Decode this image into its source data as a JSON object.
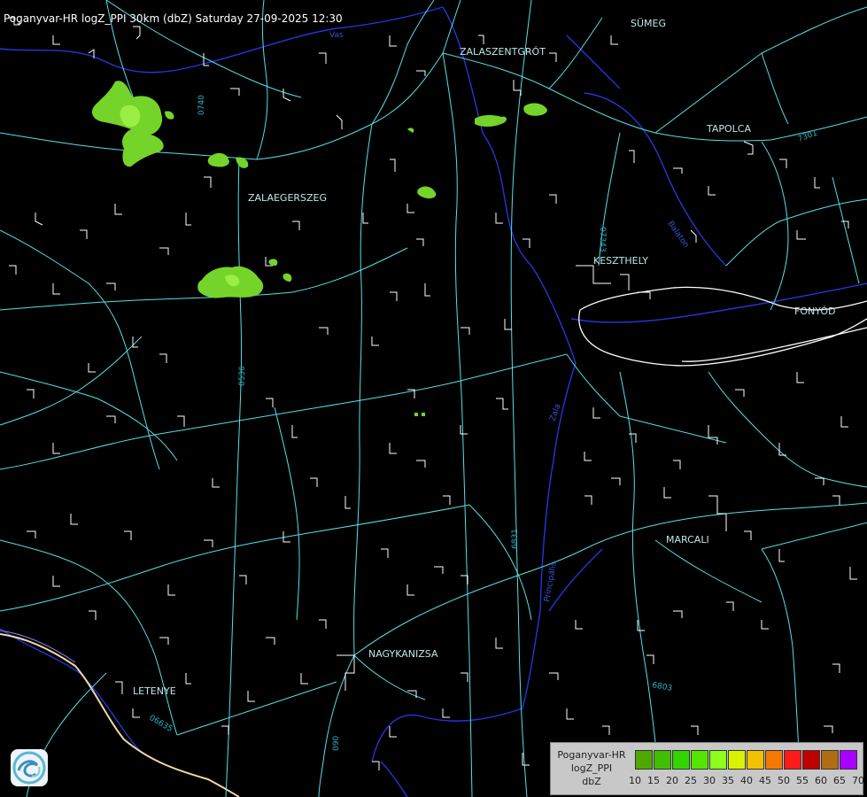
{
  "header": {
    "title": "Poganyvar-HR logZ_PPI 30km (dbZ) Saturday 27-09-2025 12:30"
  },
  "cities": [
    {
      "name": "SÜMEG"
    },
    {
      "name": "ZALASZENTGRÓT"
    },
    {
      "name": "TAPOLCA"
    },
    {
      "name": "ZALAEGERSZEG"
    },
    {
      "name": "KESZTHELY"
    },
    {
      "name": "FONYÓD"
    },
    {
      "name": "MARCALI"
    },
    {
      "name": "NAGYKANIZSA"
    },
    {
      "name": "LETENYE"
    }
  ],
  "road_labels": {
    "r0740": "0740",
    "r07343": "07343",
    "r7301": "7301",
    "r0536": "0536",
    "r6831": "6831",
    "r6803": "6803",
    "r0663s": "06635",
    "r090": "090"
  },
  "water_labels": {
    "vas": "Vas",
    "zala": "Zala",
    "principalis": "Principális",
    "batalas": "Balaton"
  },
  "legend": {
    "title_line1": "Poganyvar-HR",
    "title_line2": "logZ_PPI",
    "title_line3": "dbZ",
    "scale": [
      {
        "label": "10",
        "color": "#4ea800"
      },
      {
        "label": "15",
        "color": "#3fbf00"
      },
      {
        "label": "20",
        "color": "#33d400"
      },
      {
        "label": "25",
        "color": "#55e600"
      },
      {
        "label": "30",
        "color": "#8cff1a"
      },
      {
        "label": "35",
        "color": "#d9f200"
      },
      {
        "label": "40",
        "color": "#f2c200"
      },
      {
        "label": "45",
        "color": "#f27a00"
      },
      {
        "label": "50",
        "color": "#ff1a1a"
      },
      {
        "label": "55",
        "color": "#c00000"
      },
      {
        "label": "60",
        "color": "#b06e14"
      },
      {
        "label": "65",
        "color": "#aa00ff"
      },
      {
        "label": "70",
        "color": "#b0b0ff"
      }
    ]
  },
  "colors": {
    "roads": "#56e0e6",
    "rivers": "#2038d8",
    "settlements": "#ffffff",
    "echo_light": "#8ce63a",
    "echo_mid": "#5cc81e"
  }
}
